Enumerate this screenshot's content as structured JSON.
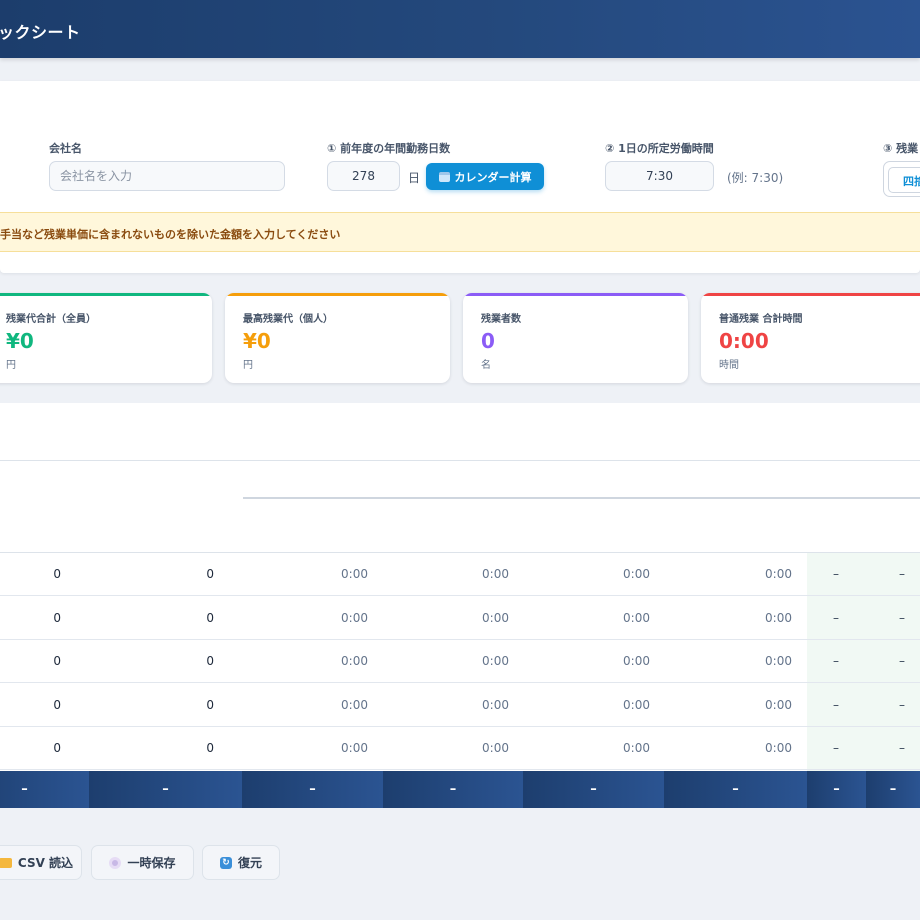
{
  "header": {
    "title": "ックシート"
  },
  "settings": {
    "company_label": "会社名",
    "company_placeholder": "会社名を入力",
    "company_value": "",
    "workdays_label": "① 前年度の年間勤務日数",
    "workdays_value": "278",
    "workdays_unit": "日",
    "calendar_button": "カレンダー計算",
    "hours_label": "② 1日の所定労働時間",
    "hours_value": "7:30",
    "hours_hint": "(例: 7:30)",
    "rounding_label": "③ 残業",
    "rounding_option": "四捨"
  },
  "notice": "手当など残業単価に含まれないものを除いた金額を入力してください",
  "stats": [
    {
      "label": "残業代合計（全員）",
      "value": "¥0",
      "unit": "円",
      "color": "#10b77f"
    },
    {
      "label": "最高残業代（個人）",
      "value": "¥0",
      "unit": "円",
      "color": "#f59e0b"
    },
    {
      "label": "残業者数",
      "value": "0",
      "unit": "名",
      "color": "#8b5cf6"
    },
    {
      "label": "普通残業 合計時間",
      "value": "0:00",
      "unit": "時間",
      "color": "#ef4444"
    }
  ],
  "table": {
    "rows": [
      [
        "0",
        "0",
        "0:00",
        "0:00",
        "0:00",
        "0:00",
        "–",
        "–"
      ],
      [
        "0",
        "0",
        "0:00",
        "0:00",
        "0:00",
        "0:00",
        "–",
        "–"
      ],
      [
        "0",
        "0",
        "0:00",
        "0:00",
        "0:00",
        "0:00",
        "–",
        "–"
      ],
      [
        "0",
        "0",
        "0:00",
        "0:00",
        "0:00",
        "0:00",
        "–",
        "–"
      ],
      [
        "0",
        "0",
        "0:00",
        "0:00",
        "0:00",
        "0:00",
        "–",
        "–"
      ]
    ],
    "totals": [
      "–",
      "–",
      "–",
      "–",
      "–",
      "–",
      "–",
      "–"
    ]
  },
  "actions": {
    "csv_label": "CSV 読込",
    "save_label": "一時保存",
    "restore_label": "復元"
  },
  "icons": {
    "calendar": "calendar-icon",
    "folder": "folder-icon",
    "disc": "disc-icon",
    "restore": "restore-icon"
  },
  "colors": {
    "header": "#24497d",
    "accent": "#0f8fd6",
    "notice_bg": "#fff7db",
    "total_row": "#244a80"
  }
}
